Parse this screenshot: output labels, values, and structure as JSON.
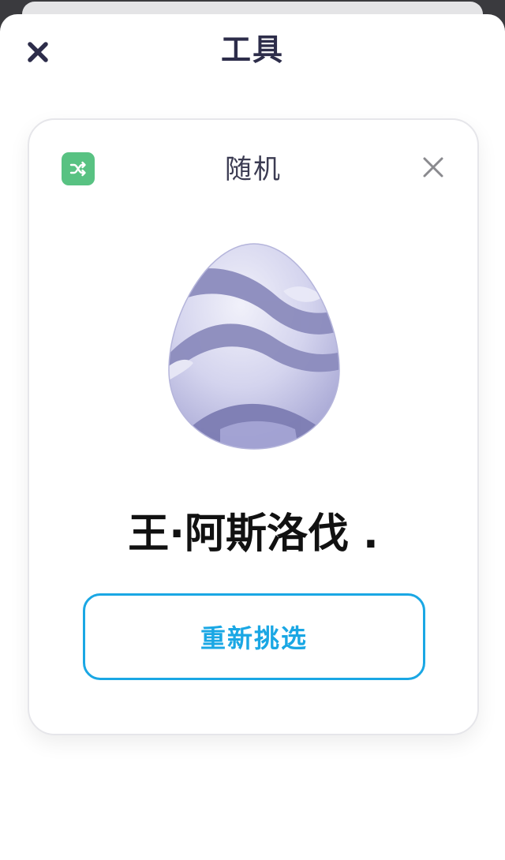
{
  "sheet": {
    "title": "工具",
    "close_icon": "close-icon"
  },
  "tool_card": {
    "icon": "shuffle-icon",
    "title": "随机",
    "close_icon": "close-icon",
    "illustration": "egg-illustration",
    "result_name": "王·阿斯洛伐 .",
    "repick_label": "重新挑选"
  },
  "colors": {
    "header_text": "#2d2d4a",
    "icon_bg": "#58c282",
    "accent": "#1aa7e4",
    "egg_base": "#c9c9ea",
    "egg_stripe": "#8c8cbd",
    "result_text": "#111111"
  }
}
